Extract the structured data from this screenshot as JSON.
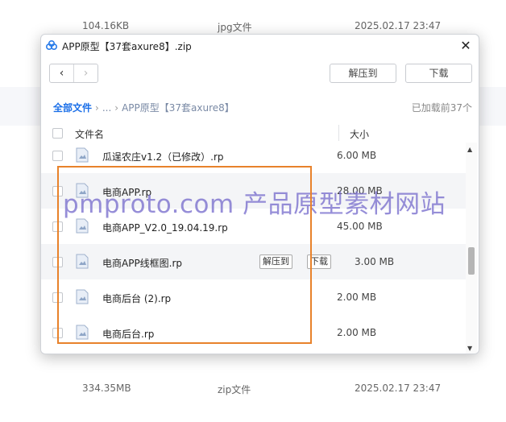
{
  "background": {
    "top_row": {
      "size": "104.16KB",
      "type": "jpg文件",
      "date": "2025.02.17 23:47"
    },
    "bottom_row": {
      "size": "334.35MB",
      "type": "zip文件",
      "date": "2025.02.17 23:47"
    }
  },
  "dialog": {
    "title": "APP原型【37套axure8】.zip",
    "close_label": "✕",
    "toolbar": {
      "back_label": "‹",
      "forward_label": "›",
      "extract_label": "解压到",
      "download_label": "下载"
    },
    "breadcrumb": {
      "root": "全部文件",
      "separator": "›",
      "ellipsis": "...",
      "current": "APP原型【37套axure8】"
    },
    "loaded_text": "已加载前37个",
    "columns": {
      "name": "文件名",
      "size": "大小"
    },
    "files": [
      {
        "name": "瓜逞农庄v1.2（已修改）.rp",
        "size": "6.00 MB"
      },
      {
        "name": "电商APP.rp",
        "size": "28.00 MB"
      },
      {
        "name": "电商APP_V2.0_19.04.19.rp",
        "size": "45.00 MB"
      },
      {
        "name": "电商APP线框图.rp",
        "size": "3.00 MB"
      },
      {
        "name": "电商后台 (2).rp",
        "size": "2.00 MB"
      },
      {
        "name": "电商后台.rp",
        "size": "2.00 MB"
      }
    ],
    "row_actions": {
      "extract": "解压到",
      "download": "下载"
    }
  },
  "watermark": "pmproto.com 产品原型素材网站",
  "colors": {
    "accent": "#1b6fe8",
    "highlight": "#e8822b",
    "watermark": "#786ecd"
  }
}
